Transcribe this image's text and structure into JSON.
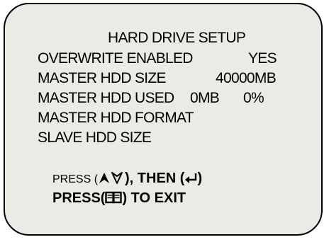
{
  "title": "HARD DRIVE SETUP",
  "menu": [
    {
      "label": "OVERWRITE ENABLED",
      "value": "YES"
    },
    {
      "label": "MASTER HDD SIZE",
      "value": "40000MB"
    },
    {
      "label": "MASTER HDD USED",
      "value": "0MB",
      "value2": "0%"
    },
    {
      "label": "MASTER HDD FORMAT"
    },
    {
      "label": "SLAVE HDD SIZE"
    }
  ],
  "instructions": {
    "press_prefix": "PRESS (",
    "then": "), THEN (",
    "close_paren": ")",
    "press_exit_prefix": "PRESS(",
    "exit_suffix": ") TO EXIT",
    "icons": [
      "up-down-arrows-icon",
      "enter-return-icon",
      "book-menu-icon"
    ]
  }
}
